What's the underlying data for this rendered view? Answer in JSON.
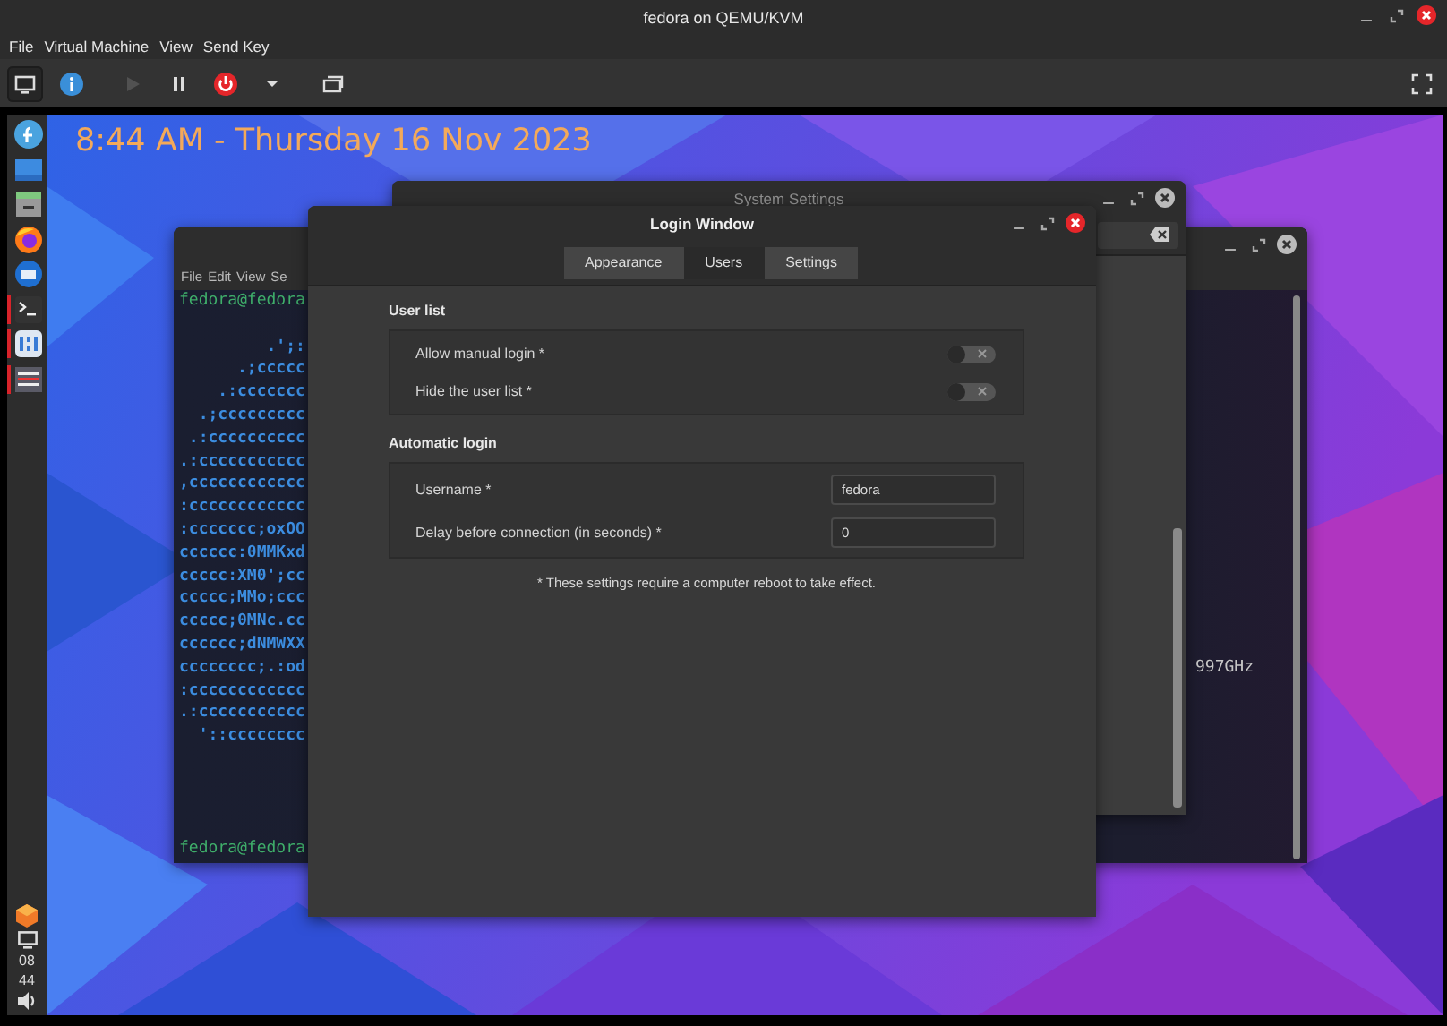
{
  "window": {
    "title": "fedora on QEMU/KVM"
  },
  "menu": [
    "File",
    "Virtual Machine",
    "View",
    "Send Key"
  ],
  "toolbar": [
    {
      "kind": "console",
      "selected": true,
      "disabled": false
    },
    {
      "kind": "info",
      "selected": false,
      "disabled": false
    },
    {
      "kind": "run",
      "selected": false,
      "disabled": true
    },
    {
      "kind": "pause",
      "selected": false,
      "disabled": false
    },
    {
      "kind": "power",
      "selected": false,
      "disabled": false
    },
    {
      "kind": "dropdown",
      "selected": false,
      "disabled": false
    },
    {
      "kind": "snapshots",
      "selected": false,
      "disabled": false
    },
    {
      "kind": "fullscreen",
      "selected": false,
      "disabled": false
    }
  ],
  "guest": {
    "clock": "8:44 AM - Thursday 16 Nov 2023",
    "dock": [
      {
        "kind": "fedora",
        "running": false
      },
      {
        "kind": "display",
        "running": false
      },
      {
        "kind": "files",
        "running": false
      },
      {
        "kind": "firefox",
        "running": false
      },
      {
        "kind": "thunderbird",
        "running": false
      },
      {
        "kind": "terminal",
        "running": true
      },
      {
        "kind": "calculator",
        "running": true
      },
      {
        "kind": "monitor",
        "running": true
      }
    ],
    "tray": {
      "time_hours": "08",
      "time_minutes": "44"
    },
    "terminal": {
      "menu": [
        "File",
        "Edit",
        "View",
        "Se"
      ],
      "prompt": "fedora@fedora",
      "lines": [
        {
          "left": "         .';:"
        },
        {
          "left": "      .;ccccc"
        },
        {
          "left": "    .:ccccccc"
        },
        {
          "left": "  .;ccccccccc"
        },
        {
          "left": " .:cccccccccc"
        },
        {
          "left": ".:ccccccccccc"
        },
        {
          "left": ",cccccccccccc"
        },
        {
          "left": ":cccccccccccc"
        },
        {
          "left": ":ccccccc;oxOO"
        },
        {
          "left": "cccccc:0MMKxd"
        },
        {
          "left": "ccccc:XM0';cc"
        },
        {
          "left": "ccccc;MMo;ccc"
        },
        {
          "left": "ccccc;0MNc.cc"
        },
        {
          "left": "cccccc;dNMWXX"
        },
        {
          "left": "cccccccc;.:od",
          "right": "997GHz"
        },
        {
          "left": ":cccccccccccc"
        },
        {
          "left": ".:ccccccccccc"
        },
        {
          "left": "  '::cccccccc"
        }
      ],
      "bottom_prompt": "fedora@fedora"
    },
    "system_settings": {
      "title": "System Settings"
    },
    "login_window": {
      "title": "Login Window",
      "tabs": [
        {
          "label": "Appearance",
          "selected": false
        },
        {
          "label": "Users",
          "selected": true
        },
        {
          "label": "Settings",
          "selected": false
        }
      ],
      "sections": [
        {
          "heading": "User list",
          "rows": [
            {
              "kind": "switch",
              "label": "Allow manual login *",
              "on": false
            },
            {
              "kind": "switch",
              "label": "Hide the user list *",
              "on": false
            }
          ]
        },
        {
          "heading": "Automatic login",
          "rows": [
            {
              "kind": "entry",
              "label": "Username *",
              "value": "fedora"
            },
            {
              "kind": "entry",
              "label": "Delay before connection (in seconds) *",
              "value": "0"
            }
          ]
        }
      ],
      "note": "* These settings require a computer reboot to take effect."
    }
  }
}
